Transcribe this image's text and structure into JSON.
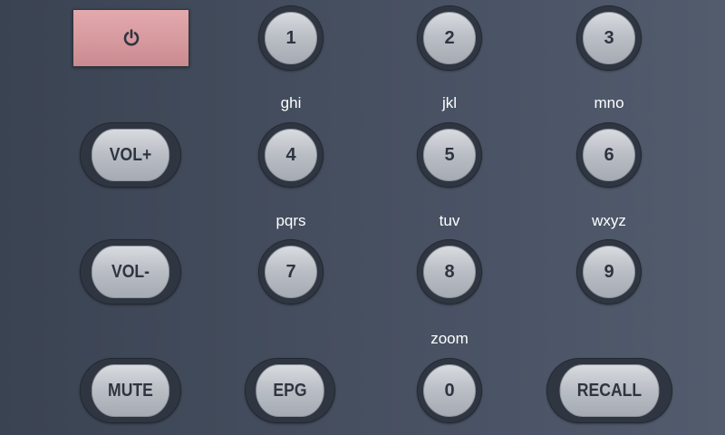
{
  "power": {
    "icon": "power-icon"
  },
  "digits": {
    "d1": "1",
    "d2": "2",
    "d3": "3",
    "d4": "4",
    "d5": "5",
    "d6": "6",
    "d7": "7",
    "d8": "8",
    "d9": "9",
    "d0": "0"
  },
  "letters": {
    "d4": "ghi",
    "d5": "jkl",
    "d6": "mno",
    "d7": "pqrs",
    "d8": "tuv",
    "d9": "wxyz",
    "d0": "zoom"
  },
  "controls": {
    "vol_up": "VOL+",
    "vol_down": "VOL-",
    "mute": "MUTE",
    "epg": "EPG",
    "recall": "RECALL"
  },
  "colors": {
    "background": "#434c5c",
    "power_button": "#d99ca1",
    "button_face": "#b9bdc4",
    "button_text": "#2f3540"
  }
}
